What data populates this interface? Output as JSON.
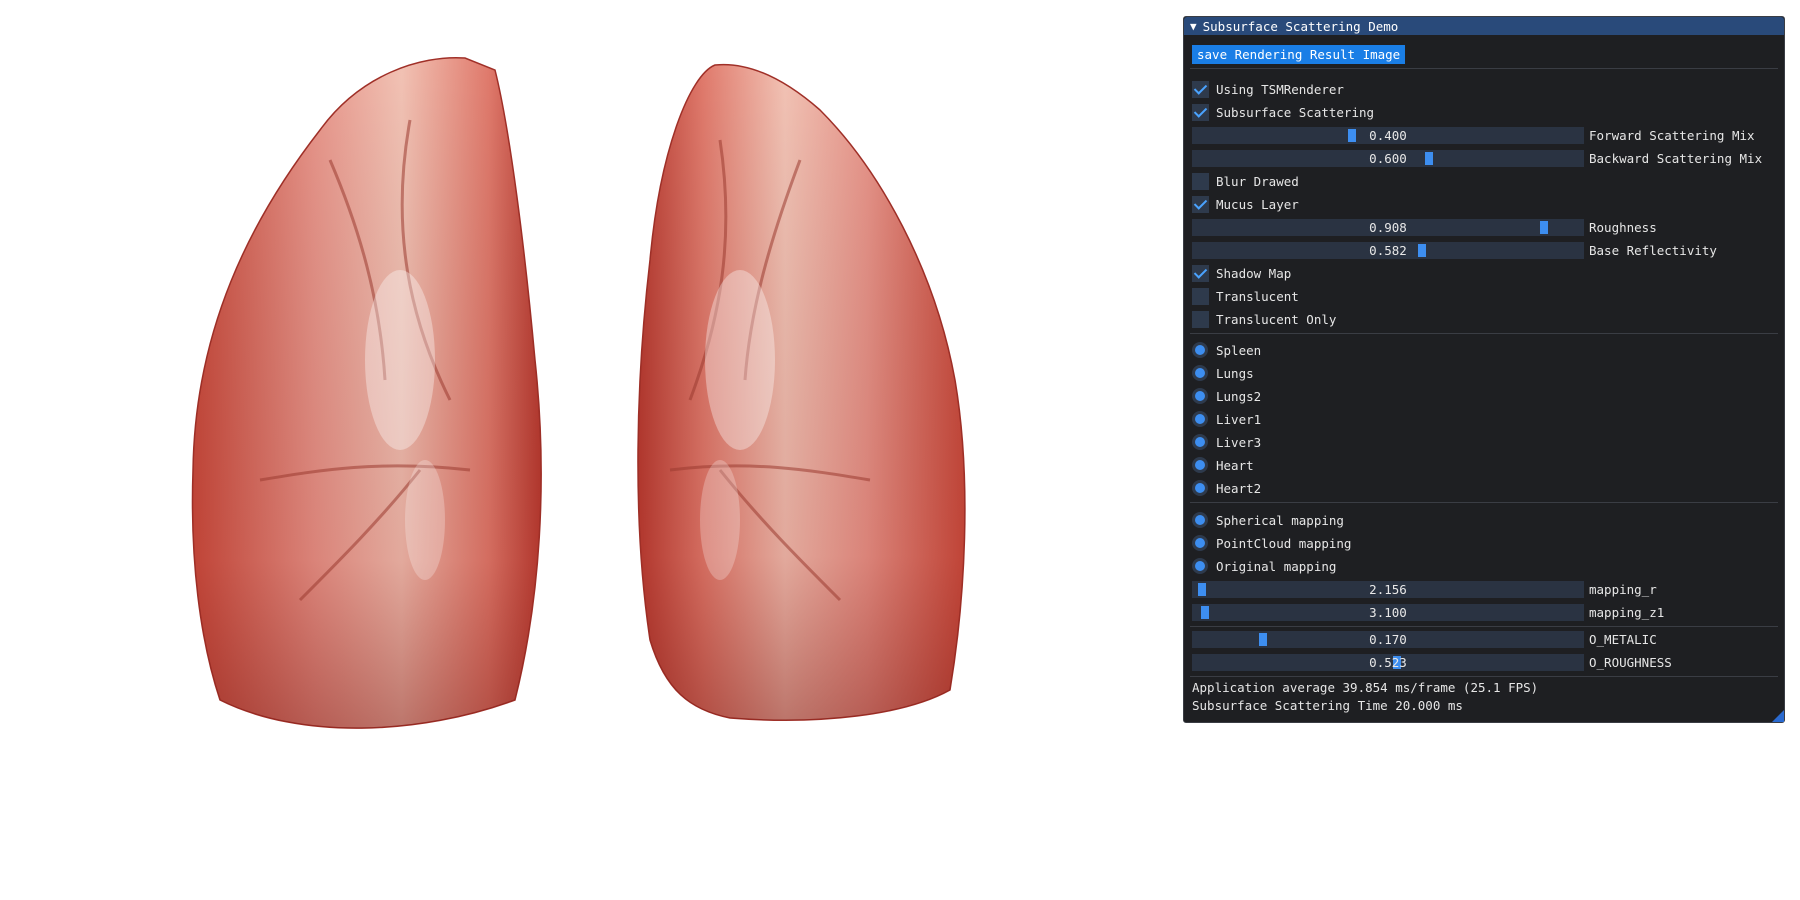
{
  "panel": {
    "title": "Subsurface Scattering Demo",
    "save_button": "save Rendering Result Image",
    "checkboxes_top": [
      {
        "label": "Using TSMRenderer",
        "checked": true
      },
      {
        "label": "Subsurface Scattering",
        "checked": true
      }
    ],
    "sliders_scatter": [
      {
        "value": "0.400",
        "label": "Forward Scattering Mix",
        "fraction": 0.4
      },
      {
        "value": "0.600",
        "label": "Backward Scattering Mix",
        "fraction": 0.6
      }
    ],
    "checkboxes_mid": [
      {
        "label": "Blur Drawed",
        "checked": false
      },
      {
        "label": "Mucus Layer",
        "checked": true
      }
    ],
    "sliders_mucus": [
      {
        "value": "0.908",
        "label": "Roughness",
        "fraction": 0.908
      },
      {
        "value": "0.582",
        "label": "Base Reflectivity",
        "fraction": 0.582
      }
    ],
    "checkboxes_bottom": [
      {
        "label": "Shadow Map",
        "checked": true
      },
      {
        "label": "Translucent",
        "checked": false
      },
      {
        "label": "Translucent Only",
        "checked": false
      }
    ],
    "models": [
      "Spleen",
      "Lungs",
      "Lungs2",
      "Liver1",
      "Liver3",
      "Heart",
      "Heart2"
    ],
    "mappings": [
      "Spherical mapping",
      "PointCloud mapping",
      "Original mapping"
    ],
    "sliders_mapping": [
      {
        "value": "2.156",
        "label": "mapping_r",
        "fraction": 0.02
      },
      {
        "value": "3.100",
        "label": "mapping_z1",
        "fraction": 0.03
      }
    ],
    "sliders_material": [
      {
        "value": "0.170",
        "label": "O_METALIC",
        "fraction": 0.17
      },
      {
        "value": "0.523",
        "label": "O_ROUGHNESS",
        "fraction": 0.523
      }
    ],
    "stats": [
      "Application average 39.854 ms/frame (25.1 FPS)",
      "Subsurface Scattering Time 20.000 ms"
    ]
  },
  "colors": {
    "panel_bg": "#1e1f22",
    "title_bg": "#294a7a",
    "accent": "#3d8ef0",
    "button": "#1a7ee6"
  }
}
